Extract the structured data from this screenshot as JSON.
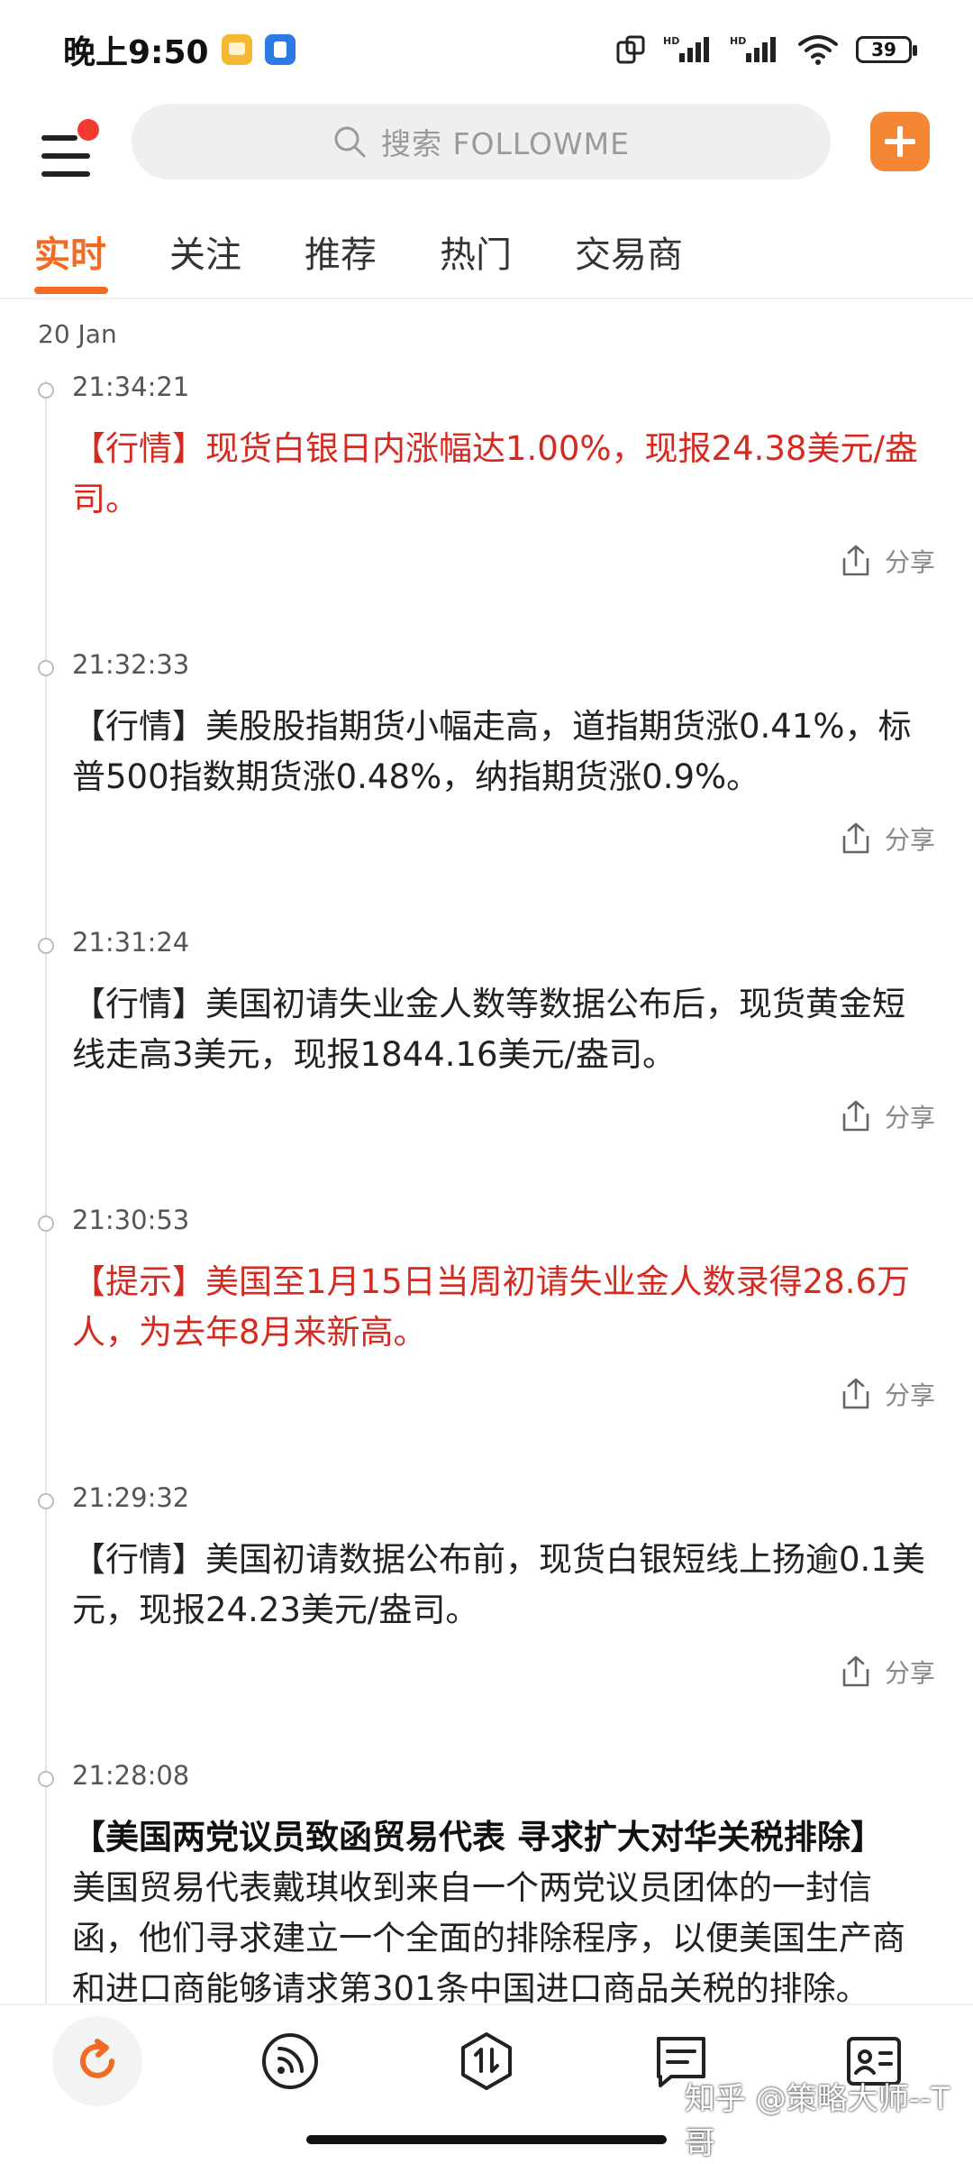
{
  "status": {
    "time": "晚上9:50",
    "battery": "39"
  },
  "search": {
    "placeholder": "搜索 FOLLOWME"
  },
  "tabs": [
    "实时",
    "关注",
    "推荐",
    "热门",
    "交易商"
  ],
  "feed": {
    "date": "20 Jan",
    "share_label": "分享",
    "items": [
      {
        "time": "21:34:21",
        "text": "【行情】现货白银日内涨幅达1.00%，现报24.38美元/盎司。"
      },
      {
        "time": "21:32:33",
        "text": "【行情】美股股指期货小幅走高，道指期货涨0.41%，标普500指数期货涨0.48%，纳指期货涨0.9%。"
      },
      {
        "time": "21:31:24",
        "text": "【行情】美国初请失业金人数等数据公布后，现货黄金短线走高3美元，现报1844.16美元/盎司。"
      },
      {
        "time": "21:30:53",
        "text": "【提示】美国至1月15日当周初请失业金人数录得28.6万人，为去年8月来新高。"
      },
      {
        "time": "21:29:32",
        "text": "【行情】美国初请数据公布前，现货白银短线上扬逾0.1美元，现报24.23美元/盎司。"
      },
      {
        "time": "21:28:08",
        "headline": "【美国两党议员致函贸易代表 寻求扩大对华关税排除】",
        "text": "美国贸易代表戴琪收到来自一个两党议员团体的一封信函，他们寻求建立一个全面的排除程序，以便美国生产商和进口商能够请求第301条中国进口商品关税的排除。"
      }
    ]
  },
  "watermark": "知乎 @策略大师--T哥",
  "colors": {
    "accent": "#f26b22",
    "alert_red": "#d42b21",
    "add_button": "#f58634"
  }
}
